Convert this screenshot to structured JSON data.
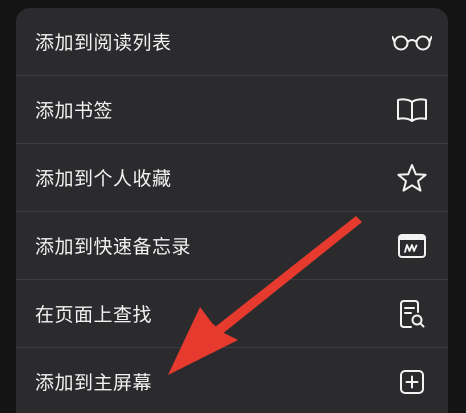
{
  "menu": {
    "items": [
      {
        "label": "添加到阅读列表",
        "icon": "glasses-icon"
      },
      {
        "label": "添加书签",
        "icon": "book-icon"
      },
      {
        "label": "添加到个人收藏",
        "icon": "star-icon"
      },
      {
        "label": "添加到快速备忘录",
        "icon": "quick-note-icon"
      },
      {
        "label": "在页面上查找",
        "icon": "find-on-page-icon"
      },
      {
        "label": "添加到主屏幕",
        "icon": "add-square-icon"
      }
    ]
  },
  "colors": {
    "menu_background": "#2b2b2e",
    "text": "#f2f2f2",
    "annotation_arrow": "#e63a2e"
  }
}
